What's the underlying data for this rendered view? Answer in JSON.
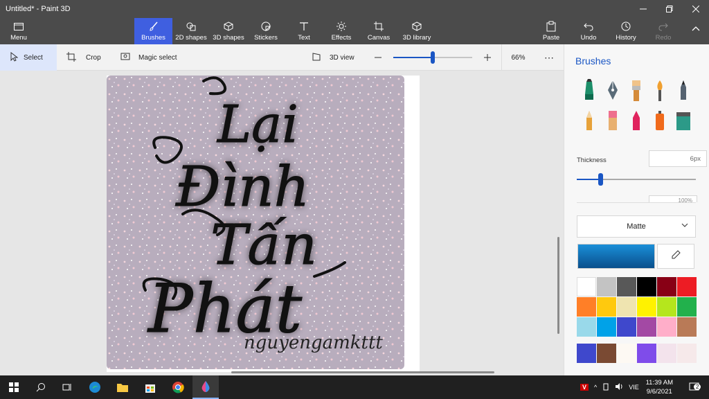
{
  "window": {
    "title": "Untitled* - Paint 3D"
  },
  "ribbon": {
    "menu": "Menu",
    "tabs": [
      {
        "label": "Brushes",
        "icon": "brush-icon",
        "active": true
      },
      {
        "label": "2D shapes",
        "icon": "2d-shapes-icon"
      },
      {
        "label": "3D shapes",
        "icon": "3d-shapes-icon"
      },
      {
        "label": "Stickers",
        "icon": "stickers-icon"
      },
      {
        "label": "Text",
        "icon": "text-icon"
      },
      {
        "label": "Effects",
        "icon": "effects-icon"
      },
      {
        "label": "Canvas",
        "icon": "canvas-icon"
      },
      {
        "label": "3D library",
        "icon": "3d-library-icon"
      }
    ],
    "right": [
      {
        "label": "Paste",
        "icon": "paste-icon"
      },
      {
        "label": "Undo",
        "icon": "undo-icon"
      },
      {
        "label": "History",
        "icon": "history-icon"
      },
      {
        "label": "Redo",
        "icon": "redo-icon",
        "disabled": true
      }
    ]
  },
  "toolbar": {
    "select": "Select",
    "crop": "Crop",
    "magic_select": "Magic select",
    "view3d": "3D view",
    "zoom": "66%",
    "zoom_level": 0.5
  },
  "canvas": {
    "lines": [
      "Lại",
      "Đình",
      "Tấn",
      "Phát"
    ],
    "signature": "nguyengamkttt",
    "background": "#b9adbd"
  },
  "panel": {
    "title": "Brushes",
    "brush_icons": [
      "marker-icon",
      "calligraphy-pen-icon",
      "oil-brush-icon",
      "watercolor-icon",
      "pencil-icon",
      "pencil-2-icon",
      "eraser-icon",
      "crayon-icon",
      "spray-can-icon",
      "fill-icon"
    ],
    "thickness_label": "Thickness",
    "thickness_value": "6px",
    "thickness_level": 0.2,
    "opacity_value": "100%",
    "finish": "Matte",
    "selected_color": "#1a8fd8",
    "colors": [
      "#ffffff",
      "#c3c3c3",
      "#585858",
      "#000000",
      "#880015",
      "#ed1c24",
      "#ff7f27",
      "#ffc90e",
      "#efe4b0",
      "#fff200",
      "#b5e61d",
      "#22b14c",
      "#99d9ea",
      "#00a2e8",
      "#3f48cc",
      "#a349a4",
      "#ffaec9",
      "#b97a57"
    ],
    "custom_colors": [
      "#3f48cc",
      "#7a4a33",
      "#fdf9f3",
      "#7f4cea",
      "#f3e3ec",
      "#f6e9ea"
    ]
  },
  "taskbar": {
    "lang": "VIE",
    "time": "11:39 AM",
    "date": "9/6/2021",
    "notifications": "2"
  }
}
